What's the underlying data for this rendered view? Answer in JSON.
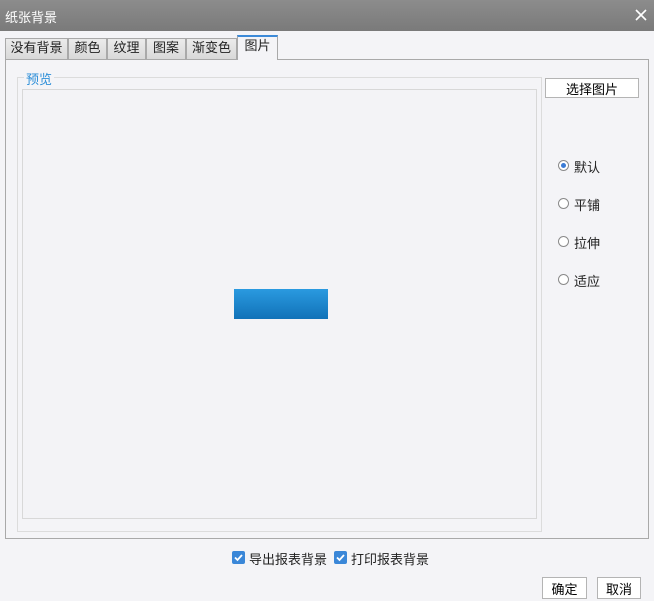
{
  "window": {
    "title": "纸张背景"
  },
  "tabs": [
    {
      "label": "没有背景"
    },
    {
      "label": "颜色"
    },
    {
      "label": "纹理"
    },
    {
      "label": "图案"
    },
    {
      "label": "渐变色"
    },
    {
      "label": "图片",
      "active": true
    }
  ],
  "preview": {
    "legend": "预览"
  },
  "select_button": {
    "label": "选择图片"
  },
  "layout_options": [
    {
      "label": "默认",
      "checked": true
    },
    {
      "label": "平铺",
      "checked": false
    },
    {
      "label": "拉伸",
      "checked": false
    },
    {
      "label": "适应",
      "checked": false
    }
  ],
  "export_options": [
    {
      "label": "导出报表背景",
      "checked": true
    },
    {
      "label": "打印报表背景",
      "checked": true
    }
  ],
  "buttons": {
    "ok": "确定",
    "cancel": "取消"
  },
  "colors": {
    "accent": "#3a87d8",
    "legend": "#2c8ed8",
    "preview_image": "#1a86cc"
  }
}
